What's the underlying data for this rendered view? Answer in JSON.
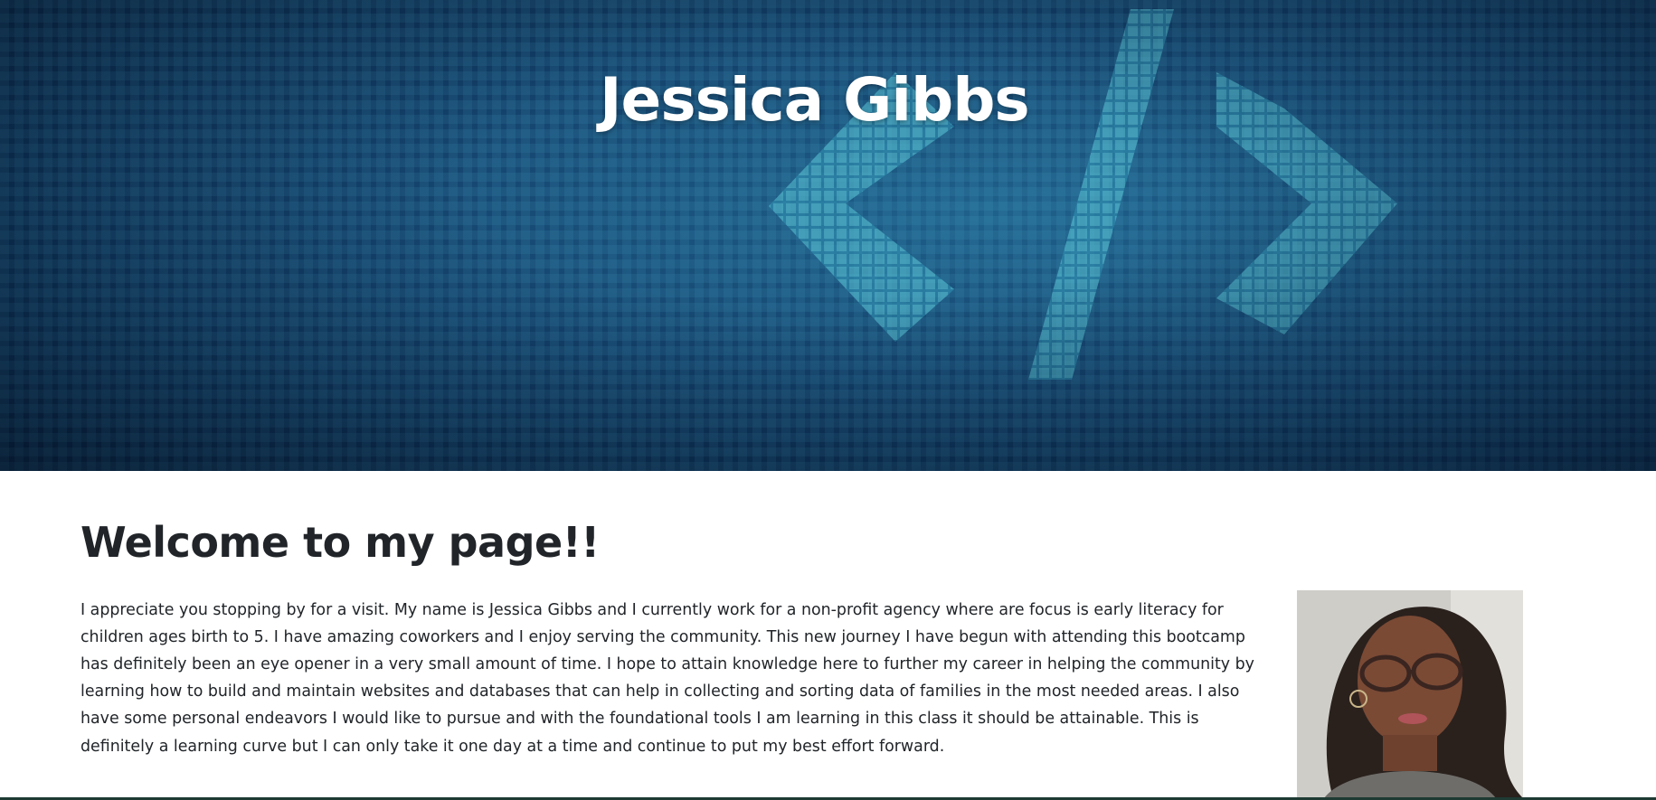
{
  "header": {
    "title": "Jessica Gibbs",
    "background_image": "code-brackets-digital-matrix",
    "colors": {
      "deep_blue": "#0a2a4f",
      "teal_glow": "#3fb3c9"
    }
  },
  "main": {
    "heading": "Welcome to my page!!",
    "about_text": "I appreciate you stopping by for a visit. My name is Jessica Gibbs and I currently work for a non-profit agency where are focus is early literacy for children ages birth to 5. I have amazing coworkers and I enjoy serving the community. This new journey I have begun with attending this bootcamp has definitely been an eye opener in a very small amount of time. I hope to attain knowledge here to further my career in helping the community by learning how to build and maintain websites and databases that can help in collecting and sorting data of families in the most needed areas. I also have some personal endeavors I would like to pursue and with the foundational tools I am learning in this class it should be attainable. This is definitely a learning curve but I can only take it one day at a time and continue to put my best effort forward.",
    "portrait": "profile-photo"
  },
  "colors": {
    "text": "#212529",
    "background": "#ffffff",
    "footer_bar": "#1e3a33"
  }
}
